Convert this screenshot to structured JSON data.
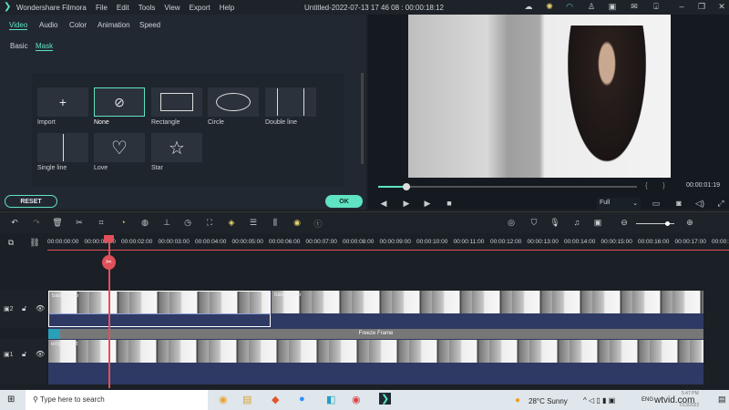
{
  "app": {
    "title": "Wondershare Filmora",
    "menu": [
      "File",
      "Edit",
      "Tools",
      "View",
      "Export",
      "Help"
    ],
    "project": "Untitled-2022-07-13 17 46 08 : 00:00:18:12"
  },
  "titlebar_icons": [
    "cloud-icon",
    "bulb-icon",
    "headset-icon",
    "user-icon",
    "save-icon",
    "mail-icon",
    "download-icon",
    "minimize-icon",
    "restore-icon",
    "close-icon"
  ],
  "tabs": [
    "Video",
    "Audio",
    "Color",
    "Animation",
    "Speed"
  ],
  "subtabs": [
    "Basic",
    "Mask"
  ],
  "masks": [
    {
      "label": "Import",
      "icon": "+"
    },
    {
      "label": "None",
      "icon": "⊘"
    },
    {
      "label": "Rectangle",
      "icon": "▭"
    },
    {
      "label": "Circle",
      "icon": "⬭"
    },
    {
      "label": "Double line",
      "icon": "| |"
    },
    {
      "label": "Single line",
      "icon": "|"
    },
    {
      "label": "Love",
      "icon": "♡"
    },
    {
      "label": "Star",
      "icon": "☆"
    }
  ],
  "buttons": {
    "reset": "RESET",
    "ok": "OK"
  },
  "player": {
    "time": "00:00:01:19",
    "quality": "Full",
    "progress_percent": 6,
    "mark_in": "{",
    "mark_out": "}"
  },
  "ruler": [
    "00:00:00:00",
    "00:00:01:00",
    "00:00:02:00",
    "00:00:03:00",
    "00:00:04:00",
    "00:00:05:00",
    "00:00:06:00",
    "00:00:07:00",
    "00:00:08:00",
    "00:00:09:00",
    "00:00:10:00",
    "00:00:11:00",
    "00:00:12:00",
    "00:00:13:00",
    "00:00:14:00",
    "00:00:15:00",
    "00:00:16:00",
    "00:00:17:00",
    "00:00:18:00"
  ],
  "tracks": {
    "v2_label": "2",
    "v1_label": "1",
    "clip_a": "base video",
    "clip_b": "base video",
    "freeze": "Freeze Frame",
    "clip_c": "empty shot"
  },
  "taskbar": {
    "search_placeholder": "Type here to search",
    "weather": "28°C  Sunny",
    "lang": "ENG",
    "time": "5:47 PM",
    "date": "7/13/2022",
    "watermark": "wtvid.com"
  },
  "colors": {
    "accent": "#5fe3c1",
    "playhead": "#e0505a",
    "track_bg": "#2e3a63"
  }
}
